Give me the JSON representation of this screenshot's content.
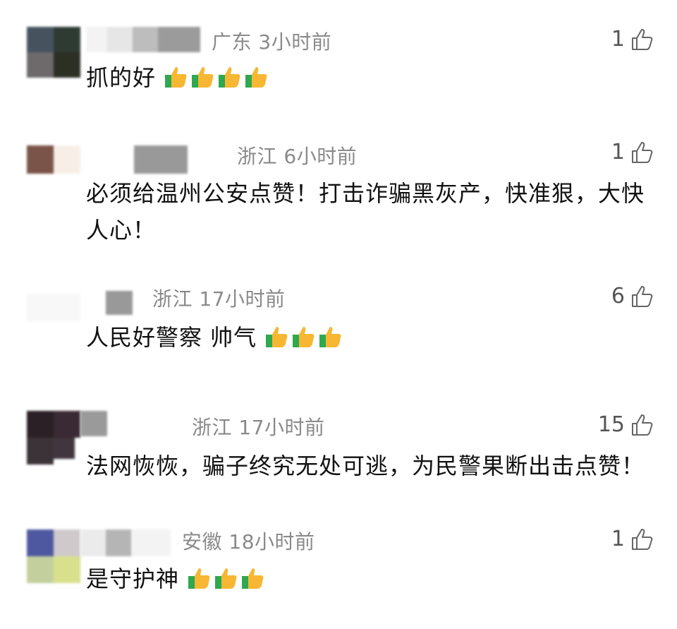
{
  "comments": [
    {
      "meta": "广东 3小时前",
      "likes": "1",
      "text": "抓的好",
      "thumbs": 4
    },
    {
      "meta": "浙江 6小时前",
      "likes": "1",
      "text": "必须给温州公安点赞！打击诈骗黑灰产，快准狠，大快人心！",
      "thumbs": 0
    },
    {
      "meta": "浙江 17小时前",
      "likes": "6",
      "text": "人民好警察  帅气",
      "thumbs": 3
    },
    {
      "meta": "浙江 17小时前",
      "likes": "15",
      "text": "法网恢恢，骗子终究无处可逃，为民警果断出击点赞！",
      "thumbs": 0
    },
    {
      "meta": "安徽 18小时前",
      "likes": "1",
      "text": "是守护神",
      "thumbs": 3
    }
  ],
  "icons": {
    "like": "thumbs-up-outline-icon",
    "emoji": "thumbs-up-emoji-icon"
  },
  "colors": {
    "meta": "#8a8a8a",
    "text": "#111111",
    "thumb_yellow": "#f7b733",
    "thumb_green": "#2fa84f"
  }
}
